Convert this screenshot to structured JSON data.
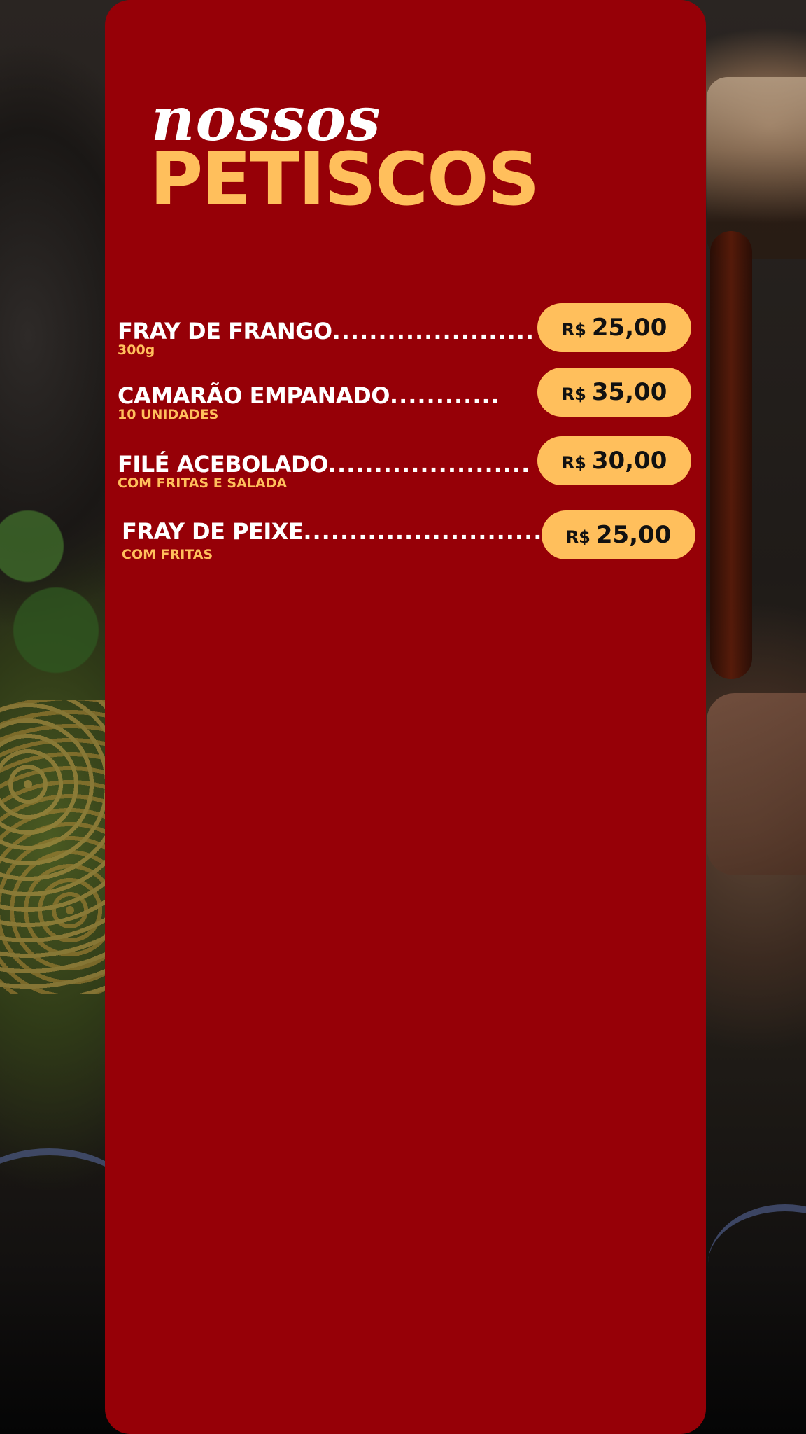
{
  "menu": {
    "title_script": "nossos",
    "title_main": "PETISCOS",
    "currency": "R$",
    "items": [
      {
        "name": "FRAY DE FRANGO",
        "dots": "......................",
        "detail": "300g",
        "price": "25,00"
      },
      {
        "name": "CAMARÃO EMPANADO",
        "dots": "............",
        "detail": "10 UNIDADES",
        "price": "35,00"
      },
      {
        "name": "FILÉ ACEBOLADO",
        "dots": ".......................",
        "detail": "COM FRITAS E SALADA",
        "price": "30,00"
      },
      {
        "name": "FRAY DE PEIXE",
        "dots": "..........................",
        "detail": "COM FRITAS",
        "price": "25,00"
      }
    ]
  },
  "colors": {
    "panel": "#960007",
    "accent": "#ffbf5c",
    "title_text": "#ffffff",
    "price_text": "#111111"
  }
}
